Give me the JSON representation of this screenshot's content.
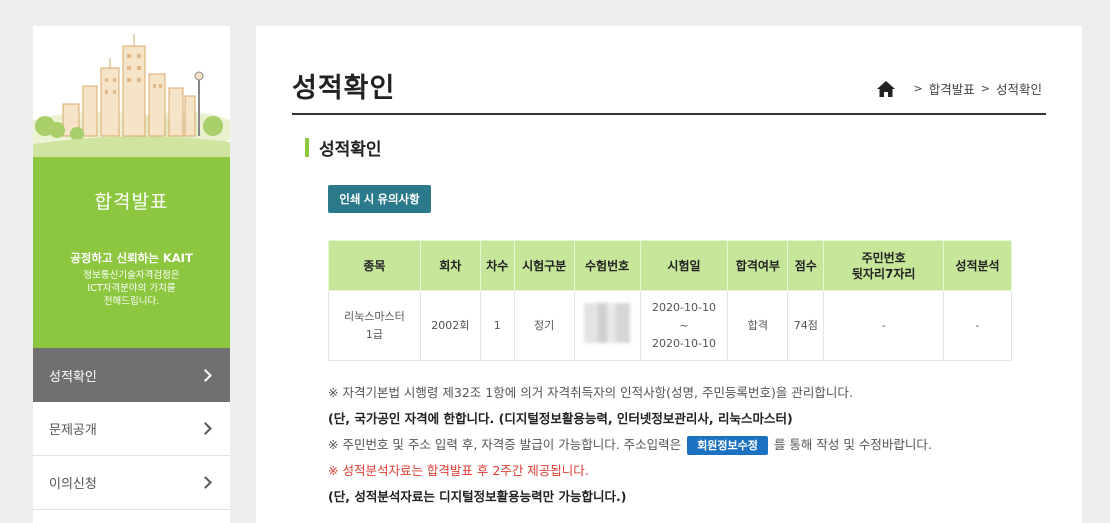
{
  "sidebar": {
    "title": "합격발표",
    "slogan": "공정하고 신뢰하는 KAIT",
    "desc_lines": [
      "정보통신기술자격검정은",
      "ICT자격분야의 가치를",
      "전해드립니다."
    ],
    "items": [
      {
        "label": "성적확인",
        "active": true
      },
      {
        "label": "문제공개",
        "active": false
      },
      {
        "label": "이의신청",
        "active": false
      }
    ]
  },
  "header": {
    "title": "성적확인",
    "breadcrumb": [
      "합격발표",
      "성적확인"
    ]
  },
  "section": {
    "title": "성적확인",
    "print_button": "인쇄 시 유의사항"
  },
  "table": {
    "headers": [
      "종목",
      "회차",
      "차수",
      "시험구분",
      "수험번호",
      "시험일",
      "합격여부",
      "점수",
      "주민번호 뒷자리7자리",
      "성적분석"
    ],
    "row": {
      "item": "리눅스마스터 1급",
      "round": "2002회",
      "session": "1",
      "type": "정기",
      "exam_no": "",
      "date_from": "2020-10-10",
      "date_sep": "~",
      "date_to": "2020-10-10",
      "result": "합격",
      "score": "74점",
      "ssn_last7": "-",
      "analysis": "-"
    }
  },
  "notes": {
    "n1": "※ 자격기본법 시행령 제32조 1항에 의거 자격취득자의 인적사항(성명, 주민등록번호)을 관리합니다.",
    "n2": "(단, 국가공인 자격에 한합니다. (디지털정보활용능력, 인터넷정보관리사, 리눅스마스터)",
    "n3_before": "※ 주민번호 및 주소 입력 후, 자격증 발급이 가능합니다. 주소입력은",
    "n3_button": "회원정보수정",
    "n3_after": "를 통해 작성 및 수정바랍니다.",
    "n4": "※ 성적분석자료는 합격발표 후 2주간 제공됩니다.",
    "n5": "(단, 성적분석자료는 디지털정보활용능력만 가능합니다.)"
  },
  "colors": {
    "accent_green": "#8dc63f",
    "header_green": "#c6e69a",
    "teal_button": "#2b7a8c",
    "blue_button": "#1b72c0",
    "note_red": "#e03c31"
  }
}
